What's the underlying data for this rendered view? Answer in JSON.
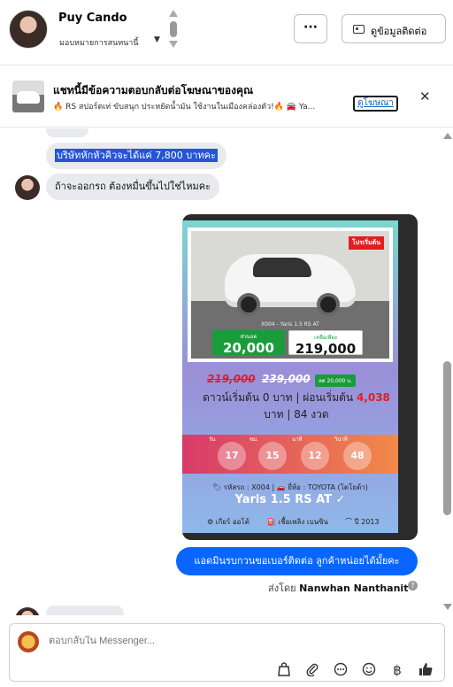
{
  "header": {
    "contact_name": "Puy Cando",
    "assign_label": "มอบหมายการสนทนานี้",
    "more_label": "···",
    "contact_info_label": "ดูข้อมูลติดต่อ"
  },
  "ad_banner": {
    "title": "แชทนี้มีข้อความตอบกลับต่อโฆษณาของคุณ",
    "subtitle": "🔥 RS สปอร์ตเท่ ขับสนุก ประหยัดน้ำมัน ใช้งานในเมืองคล่องตัว!🔥 🚘 Ya...",
    "view_ad_label": "ดูโฆษณา",
    "close_label": "✕"
  },
  "messages": [
    {
      "direction": "in",
      "text": "บริษัทหักหัวคิวจะได้แค่ 7,800 บาทคะ"
    },
    {
      "direction": "in",
      "text": "ถ้าจะออกรถ ต้องหมื่นขึ้นไปใช่ไหมคะ"
    }
  ],
  "ad_card": {
    "promo_tag": "โปรเริ่มต้น",
    "model_caption": "X004 - Yaris 1.5 RS AT",
    "down_label": "ส่วนลด",
    "down_value": "20,000",
    "remain_label": "เหลือเพียง",
    "remain_value": "219,000",
    "old_price_1": "219,000",
    "old_price_2": "239,000",
    "discount_badge": "ลด 20,000 บ.",
    "terms_prefix": "ดาวน์เริ่มต้น 0 บาท | ผ่อนเริ่มต้น ",
    "installment": "4,038",
    "terms_suffix": " บาท | 84 งวด",
    "countdown": [
      {
        "label": "วัน",
        "value": "17"
      },
      {
        "label": "ชม.",
        "value": "15"
      },
      {
        "label": "นาที",
        "value": "12"
      },
      {
        "label": "วินาที",
        "value": "48"
      }
    ],
    "details": "🏷 รหัสรถ : X004 | 🚗 ยี่ห้อ : TOYOTA (โตโยต้า)",
    "model_name": "Yaris 1.5 RS AT ✓",
    "spec_gear": "⚙ เกียร์ ออโต้",
    "spec_fuel": "⛽ เชื้อเพลิง เบนซิน",
    "spec_year": "⌒ ปี 2013"
  },
  "outgoing": {
    "text": "แอดมินรบกวนขอเบอร์ติดต่อ ลูกค้าหน่อยได้มั้ยคะ",
    "sent_by_prefix": "ส่งโดย ",
    "sender": "Nanwhan Nanthanit",
    "info_icon": "?"
  },
  "composer": {
    "placeholder": "ตอบกลับใน Messenger...",
    "icons": [
      "bag-icon",
      "paperclip-icon",
      "chat-bubble-icon",
      "emoji-icon",
      "baht-icon",
      "thumbs-up-icon"
    ]
  },
  "colors": {
    "accent": "#0866ff",
    "selection": "#2455d8",
    "incoming_bubble": "#e9eaed"
  }
}
